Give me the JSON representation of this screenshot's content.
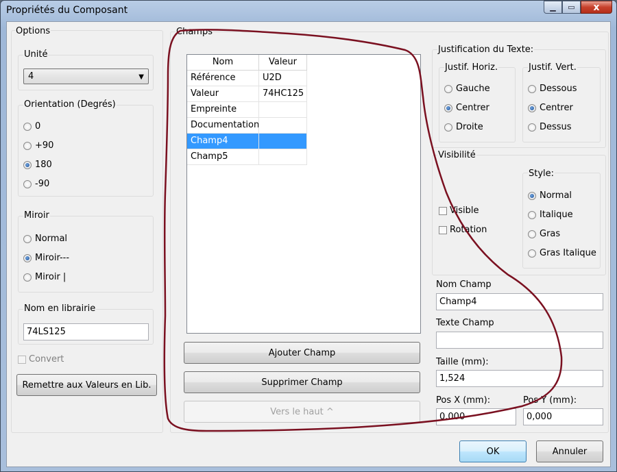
{
  "window": {
    "title": "Propriétés du Composant",
    "min": "0",
    "max": "1",
    "close": "x"
  },
  "options": {
    "label": "Options",
    "unit": {
      "label": "Unité",
      "value": "4"
    },
    "orientation": {
      "label": "Orientation (Degrés)",
      "items": [
        {
          "label": "0",
          "selected": false
        },
        {
          "label": "+90",
          "selected": false
        },
        {
          "label": "180",
          "selected": true
        },
        {
          "label": "-90",
          "selected": false
        }
      ]
    },
    "mirror": {
      "label": "Miroir",
      "items": [
        {
          "label": "Normal",
          "selected": false
        },
        {
          "label": "Miroir---",
          "selected": true
        },
        {
          "label": "Miroir |",
          "selected": false
        }
      ]
    },
    "library_name": {
      "label": "Nom en librairie",
      "value": "74LS125"
    },
    "convert": {
      "label": "Convert",
      "checked": false
    },
    "reset_button": "Remettre aux Valeurs en Lib."
  },
  "fields": {
    "label": "Champs",
    "columns": [
      "Nom",
      "Valeur"
    ],
    "rows": [
      {
        "name": "Référence",
        "value": "U2D"
      },
      {
        "name": "Valeur",
        "value": "74HC125"
      },
      {
        "name": "Empreinte",
        "value": ""
      },
      {
        "name": "Documentation",
        "value": ""
      },
      {
        "name": "Champ4",
        "value": ""
      },
      {
        "name": "Champ5",
        "value": ""
      }
    ],
    "selected_row": 4,
    "add_button": "Ajouter Champ",
    "delete_button": "Supprimer Champ",
    "move_up_button": "Vers le haut ^"
  },
  "justification": {
    "label": "Justification du Texte:",
    "horiz": {
      "label": "Justif. Horiz.",
      "items": [
        {
          "label": "Gauche",
          "selected": false
        },
        {
          "label": "Centrer",
          "selected": true
        },
        {
          "label": "Droite",
          "selected": false
        }
      ]
    },
    "vert": {
      "label": "Justif. Vert.",
      "items": [
        {
          "label": "Dessous",
          "selected": false
        },
        {
          "label": "Centrer",
          "selected": true
        },
        {
          "label": "Dessus",
          "selected": false
        }
      ]
    }
  },
  "visibility": {
    "label": "Visibilité",
    "visible": {
      "label": "Visible",
      "checked": false
    },
    "rotation": {
      "label": "Rotation",
      "checked": false
    },
    "style": {
      "label": "Style:",
      "items": [
        {
          "label": "Normal",
          "selected": true
        },
        {
          "label": "Italique",
          "selected": false
        },
        {
          "label": "Gras",
          "selected": false
        },
        {
          "label": "Gras Italique",
          "selected": false
        }
      ]
    }
  },
  "field_name": {
    "label": "Nom Champ",
    "value": "Champ4"
  },
  "field_text": {
    "label": "Texte Champ",
    "value": ""
  },
  "size": {
    "label": "Taille  (mm):",
    "value": "1,524"
  },
  "pos_x": {
    "label": "Pos X (mm):",
    "value": "0,000"
  },
  "pos_y": {
    "label": "Pos Y (mm):",
    "value": "0,000"
  },
  "ok_button": "OK",
  "cancel_button": "Annuler",
  "colors": {
    "annotation": "#7a1020",
    "selection": "#3399ff"
  }
}
